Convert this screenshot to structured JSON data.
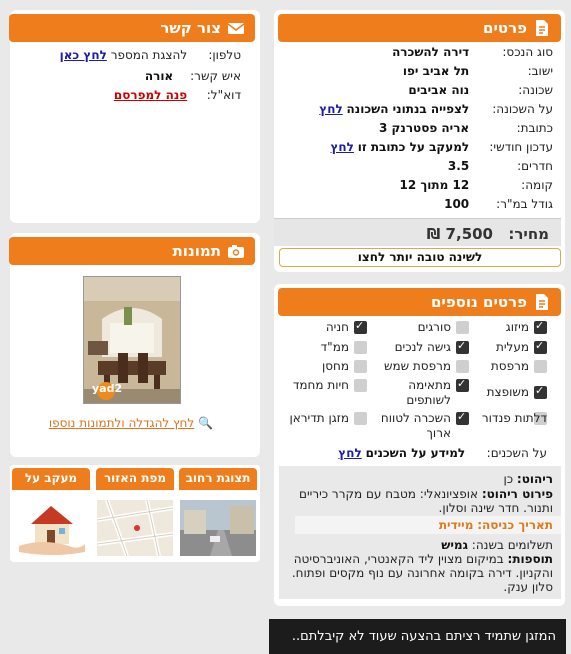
{
  "details": {
    "title": "פרטים",
    "rows": [
      {
        "label": "סוג הנכס:",
        "value": "דירה להשכרה"
      },
      {
        "label": "ישוב:",
        "value": "תל אביב יפו"
      },
      {
        "label": "שכונה:",
        "value": "נוה אביבים"
      },
      {
        "label": "על השכונה:",
        "value": "לצפייה בנתוני השכונה",
        "link": "לחץ"
      },
      {
        "label": "כתובת:",
        "value": "אריה פסטרנק 3"
      },
      {
        "label": "עדכון חודשי:",
        "value": "למעקב על כתובת זו",
        "link": "לחץ"
      },
      {
        "label": "חדרים:",
        "value": "3.5"
      },
      {
        "label": "קומה:",
        "value": "12 מתוך 12"
      },
      {
        "label": "גודל במ\"ר:",
        "value": "100"
      }
    ],
    "price_label": "מחיר:",
    "price_value": "₪ 7,500",
    "better_button": "לשינה טובה יותר לחצו"
  },
  "contact": {
    "title": "צור קשר",
    "phone_label": "טלפון:",
    "phone_text": "להצגת המספר",
    "phone_link": "לחץ כאן",
    "person_label": "איש קשר:",
    "person_value": "אורה",
    "email_label": "דוא\"ל:",
    "email_link": "פנה למפרסם"
  },
  "photos": {
    "title": "תמונות",
    "watermark": "yad2",
    "enlarge_link": "לחץ להגדלה ולתמונות נוספו"
  },
  "tabs": [
    {
      "label": "תצוגת רחוב"
    },
    {
      "label": "מפת האזור"
    },
    {
      "label": "מעקב על בנכס"
    }
  ],
  "extras": {
    "title": "פרטים נוספים",
    "features": [
      {
        "label": "מיזוג",
        "checked": true
      },
      {
        "label": "סורגים",
        "checked": false
      },
      {
        "label": "חניה",
        "checked": true
      },
      {
        "label": "מעלית",
        "checked": true
      },
      {
        "label": "גישה לנכים",
        "checked": true
      },
      {
        "label": "ממ\"ד",
        "checked": false
      },
      {
        "label": "מרפסת",
        "checked": false
      },
      {
        "label": "מרפסת שמש",
        "checked": false
      },
      {
        "label": "מחסן",
        "checked": false
      },
      {
        "label": "משופצת",
        "checked": true
      },
      {
        "label": "מתאימה לשותפים",
        "checked": true
      },
      {
        "label": "חיות מחמד",
        "checked": false
      },
      {
        "label": "דלתות פנדור",
        "checked": false
      },
      {
        "label": "השכרה לטווח ארוך",
        "checked": true
      },
      {
        "label": "מזגן תדיראן",
        "checked": false
      }
    ],
    "neighbors_label": "על השכנים:",
    "neighbors_text": "למידע על השכנים",
    "neighbors_link": "לחץ"
  },
  "info": {
    "furnish_label": "ריהוט:",
    "furnish_value": "כן",
    "furnish_detail_label": "פירוט ריהוט:",
    "furnish_detail_value": "אופציונאלי: מטבח עם מקרר כיריים ותנור. חדר שינה וסלון.",
    "entry_label": "תאריך כניסה:",
    "entry_value": "מיידית",
    "payments_label": "תשלומים בשנה:",
    "payments_value": "גמיש",
    "additions_label": "תוספות:",
    "additions_value": "במיקום מצוין ליד הקאנטרי, האוניברסיטה והקניון. דירה בקומה אחרונה עם נוף מקסים ופתוח. סלון ענק."
  },
  "banner": {
    "text": "המזגן שתמיד רציתם בהצעה שעוד לא קיבלתם.."
  }
}
